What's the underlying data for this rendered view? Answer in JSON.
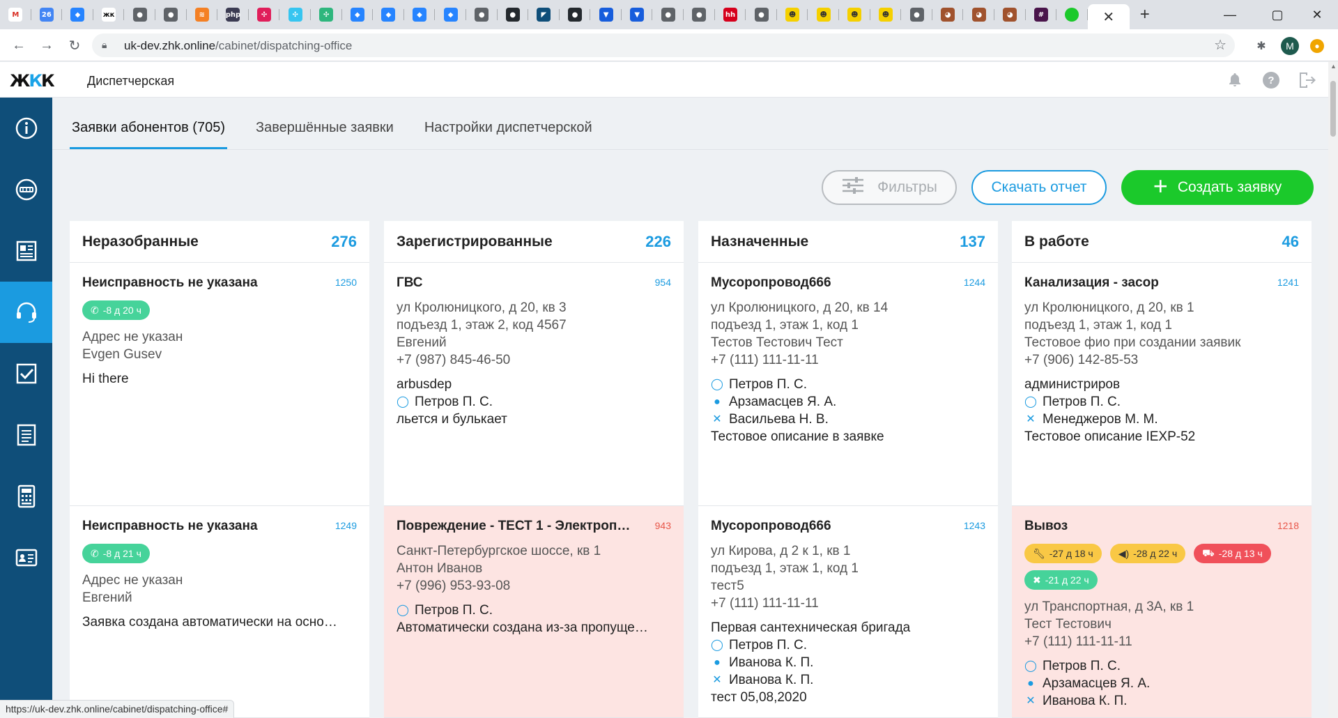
{
  "browser": {
    "favicons": [
      {
        "name": "gmail-icon",
        "glyph": "M",
        "bg": "#ffffff",
        "fg": "#d93025"
      },
      {
        "name": "calendar-icon",
        "glyph": "26",
        "bg": "#4285f4",
        "fg": "#ffffff"
      },
      {
        "name": "jira-icon",
        "glyph": "◆",
        "bg": "#2684ff",
        "fg": "#ffffff"
      },
      {
        "name": "zhk-icon",
        "glyph": "жк",
        "bg": "#ffffff",
        "fg": "#111111"
      },
      {
        "name": "globe-icon",
        "glyph": "●",
        "bg": "#5f6368",
        "fg": "#ffffff"
      },
      {
        "name": "globe-icon",
        "glyph": "●",
        "bg": "#5f6368",
        "fg": "#ffffff"
      },
      {
        "name": "stackoverflow-icon",
        "glyph": "≋",
        "bg": "#f48024",
        "fg": "#ffffff"
      },
      {
        "name": "php-icon",
        "glyph": "php",
        "bg": "#3b3b52",
        "fg": "#ffffff"
      },
      {
        "name": "slack-icon",
        "glyph": "✣",
        "bg": "#e01e5a",
        "fg": "#ffffff"
      },
      {
        "name": "slack-icon",
        "glyph": "✣",
        "bg": "#36c5f0",
        "fg": "#ffffff"
      },
      {
        "name": "slack-icon",
        "glyph": "✣",
        "bg": "#2eb67d",
        "fg": "#ffffff"
      },
      {
        "name": "jira-icon",
        "glyph": "◆",
        "bg": "#2684ff",
        "fg": "#ffffff"
      },
      {
        "name": "jira-icon",
        "glyph": "◆",
        "bg": "#2684ff",
        "fg": "#ffffff"
      },
      {
        "name": "jira-icon",
        "glyph": "◆",
        "bg": "#2684ff",
        "fg": "#ffffff"
      },
      {
        "name": "jira-icon",
        "glyph": "◆",
        "bg": "#2684ff",
        "fg": "#ffffff"
      },
      {
        "name": "globe-icon",
        "glyph": "●",
        "bg": "#5f6368",
        "fg": "#ffffff"
      },
      {
        "name": "github-icon",
        "glyph": "●",
        "bg": "#24292e",
        "fg": "#ffffff"
      },
      {
        "name": "app-icon",
        "glyph": "◤",
        "bg": "#0f4e79",
        "fg": "#ffffff"
      },
      {
        "name": "github-icon",
        "glyph": "●",
        "bg": "#24292e",
        "fg": "#ffffff"
      },
      {
        "name": "bitwarden-icon",
        "glyph": "▼",
        "bg": "#175ddc",
        "fg": "#ffffff"
      },
      {
        "name": "bitwarden-icon",
        "glyph": "▼",
        "bg": "#175ddc",
        "fg": "#ffffff"
      },
      {
        "name": "globe-icon",
        "glyph": "●",
        "bg": "#5f6368",
        "fg": "#ffffff"
      },
      {
        "name": "globe-icon",
        "glyph": "●",
        "bg": "#5f6368",
        "fg": "#ffffff"
      },
      {
        "name": "hh-icon",
        "glyph": "hh",
        "bg": "#d6001c",
        "fg": "#ffffff"
      },
      {
        "name": "globe-icon",
        "glyph": "●",
        "bg": "#5f6368",
        "fg": "#ffffff"
      },
      {
        "name": "emoji-icon",
        "glyph": "☻",
        "bg": "#f5d000",
        "fg": "#333333"
      },
      {
        "name": "emoji-icon",
        "glyph": "☻",
        "bg": "#f5d000",
        "fg": "#333333"
      },
      {
        "name": "emoji-icon",
        "glyph": "☻",
        "bg": "#f5d000",
        "fg": "#333333"
      },
      {
        "name": "emoji-icon",
        "glyph": "☻",
        "bg": "#f5d000",
        "fg": "#333333"
      },
      {
        "name": "globe-icon",
        "glyph": "●",
        "bg": "#5f6368",
        "fg": "#ffffff"
      },
      {
        "name": "animal-icon",
        "glyph": "◕",
        "bg": "#a0522d",
        "fg": "#ffffff"
      },
      {
        "name": "animal-icon",
        "glyph": "◕",
        "bg": "#a0522d",
        "fg": "#ffffff"
      },
      {
        "name": "animal-icon",
        "glyph": "◕",
        "bg": "#a0522d",
        "fg": "#ffffff"
      },
      {
        "name": "slack-grid-icon",
        "glyph": "#",
        "bg": "#4a154b",
        "fg": "#ffffff"
      },
      {
        "name": "green-dot-icon",
        "glyph": "",
        "bg": "#1bc92b",
        "fg": "#ffffff"
      }
    ],
    "active_tab_close": "✕",
    "new_tab": "+",
    "url_host": "uk-dev.zhk.online",
    "url_path": "/cabinet/dispatching-office",
    "profile_letter": "M",
    "status_url": "https://uk-dev.zhk.online/cabinet/dispatching-office#"
  },
  "app": {
    "logo_left": "Ж",
    "logo_mid": "К",
    "logo_right": "К",
    "title": "Диспетчерская"
  },
  "tabs": [
    {
      "label": "Заявки абонентов (705)",
      "active": true
    },
    {
      "label": "Завершённые заявки",
      "active": false
    },
    {
      "label": "Настройки диспетчерской",
      "active": false
    }
  ],
  "actions": {
    "filter": "Фильтры",
    "report": "Скачать отчет",
    "create": "Создать заявку"
  },
  "colors": {
    "accent": "#1b9be0",
    "sidebar": "#0f4e79",
    "create": "#1bc92b",
    "overdue": "#fde4e2"
  },
  "columns": [
    {
      "title": "Неразобранные",
      "count": "276",
      "cards": [
        {
          "title": "Неисправность не указана",
          "num": "1250",
          "overdue": false,
          "badges": [
            {
              "kind": "green",
              "icon": "phone-icon",
              "text": "-8 д 20 ч"
            }
          ],
          "info": [
            "Адрес не указан",
            "Evgen Gusev"
          ],
          "people": [],
          "desc": "Hi there"
        },
        {
          "title": "Неисправность не указана",
          "num": "1249",
          "overdue": false,
          "badges": [
            {
              "kind": "green",
              "icon": "phone-icon",
              "text": "-8 д 21 ч"
            }
          ],
          "info": [
            "Адрес не указан",
            "Евгений"
          ],
          "people": [],
          "desc": "Заявка создана автоматически на осно…"
        }
      ]
    },
    {
      "title": "Зарегистрированные",
      "count": "226",
      "cards": [
        {
          "title": "ГВС",
          "num": "954",
          "overdue": false,
          "badges": [],
          "info": [
            "ул Кролюницкого, д 20, кв 3",
            "подъезд 1, этаж 2, код 4567",
            "Евгений",
            "+7 (987) 845-46-50"
          ],
          "group": "arbusdep",
          "people": [
            {
              "role": "dispatcher-icon",
              "name": "Петров П. С."
            }
          ],
          "desc": "льется и булькает"
        },
        {
          "title": "Повреждение - ТЕСТ 1 - Электроп…",
          "num": "943",
          "overdue": true,
          "badges": [],
          "info": [
            "Санкт-Петербургское шоссе, кв 1",
            "Антон Иванов",
            "+7 (996) 953-93-08"
          ],
          "people": [
            {
              "role": "dispatcher-icon",
              "name": "Петров П. С."
            }
          ],
          "desc": "Автоматически создана из-за пропуще…"
        }
      ]
    },
    {
      "title": "Назначенные",
      "count": "137",
      "cards": [
        {
          "title": "Мусоропровод666",
          "num": "1244",
          "overdue": false,
          "badges": [],
          "info": [
            "ул Кролюницкого, д 20, кв 14",
            "подъезд 1, этаж 1, код 1",
            "Тестов Тестович Тест",
            "+7 (111) 111-11-11"
          ],
          "people": [
            {
              "role": "dispatcher-icon",
              "name": "Петров П. С."
            },
            {
              "role": "master-icon",
              "name": "Арзамасцев Я. А."
            },
            {
              "role": "worker-icon",
              "name": "Васильева Н. В."
            }
          ],
          "desc": "Тестовое описание в заявке"
        },
        {
          "title": "Мусоропровод666",
          "num": "1243",
          "overdue": false,
          "badges": [],
          "info": [
            "ул Кирова, д 2 к 1, кв 1",
            "подъезд 1, этаж 1, код 1",
            "тест5",
            "+7 (111) 111-11-11"
          ],
          "group": "Первая сантехническая бригада",
          "people": [
            {
              "role": "dispatcher-icon",
              "name": "Петров П. С."
            },
            {
              "role": "master-icon",
              "name": "Иванова К. П."
            },
            {
              "role": "worker-icon",
              "name": "Иванова К. П."
            }
          ],
          "desc": "тест 05,08,2020"
        }
      ]
    },
    {
      "title": "В работе",
      "count": "46",
      "cards": [
        {
          "title": "Канализация - засор",
          "num": "1241",
          "overdue": false,
          "badges": [],
          "info": [
            "ул Кролюницкого, д 20, кв 1",
            "подъезд 1, этаж 1, код 1",
            "Тестовое фио при создании заявик",
            "+7 (906) 142-85-53"
          ],
          "group": "администриров",
          "people": [
            {
              "role": "dispatcher-icon",
              "name": "Петров П. С."
            },
            {
              "role": "worker-icon",
              "name": "Менеджеров М. М."
            }
          ],
          "desc": "Тестовое описание IEXP-52"
        },
        {
          "title": "Вывоз",
          "num": "1218",
          "overdue": true,
          "badges": [
            {
              "kind": "yellow",
              "icon": "wrench-icon",
              "text": "-27 д 18 ч"
            },
            {
              "kind": "yellow",
              "icon": "megaphone-icon",
              "text": "-28 д 22 ч"
            },
            {
              "kind": "red",
              "icon": "truck-icon",
              "text": "-28 д 13 ч"
            },
            {
              "kind": "green",
              "icon": "tools-icon",
              "text": "-21 д 22 ч"
            }
          ],
          "info": [
            "ул Транспортная, д 3А, кв 1",
            "Тест Тестович",
            "+7 (111) 111-11-11"
          ],
          "people": [
            {
              "role": "dispatcher-icon",
              "name": "Петров П. С."
            },
            {
              "role": "master-icon",
              "name": "Арзамасцев Я. А."
            },
            {
              "role": "worker-icon",
              "name": "Иванова К. П."
            }
          ],
          "desc": ""
        }
      ]
    }
  ]
}
